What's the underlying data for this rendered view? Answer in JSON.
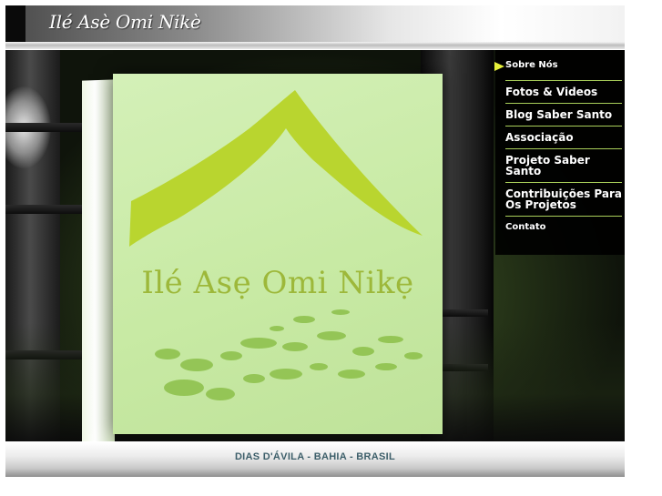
{
  "header": {
    "site_title": "Ilé Asè Omi Nikè"
  },
  "hero": {
    "logo_text": "Ilé Asẹ Omi Nikẹ"
  },
  "nav": {
    "items": [
      {
        "label": "Sobre Nós"
      },
      {
        "label": "Fotos & Videos"
      },
      {
        "label": "Blog Saber Santo"
      },
      {
        "label": "Associação"
      },
      {
        "label": "Projeto Saber Santo"
      },
      {
        "label": "Contribuições Para Os Projetos"
      },
      {
        "label": "Contato"
      }
    ]
  },
  "footer": {
    "location": "DIAS D'ÁVILA - BAHIA - BRASIL"
  },
  "colors": {
    "accent_green": "#a9cf5a",
    "logo_green": "#9db83a",
    "arrow_yellow": "#e6f03a",
    "footer_text": "#3d5f6a"
  }
}
